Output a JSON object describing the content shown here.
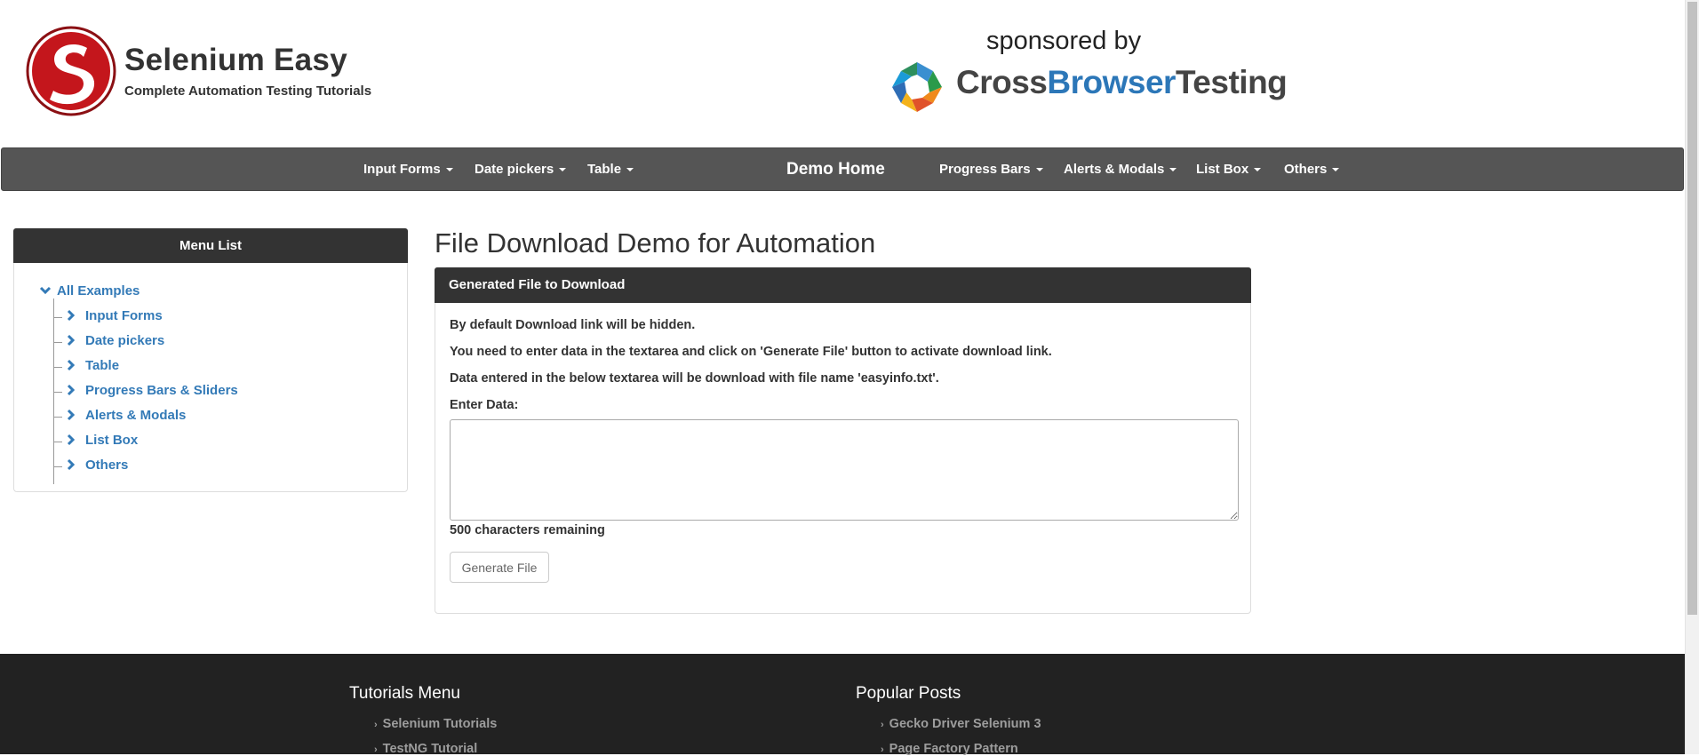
{
  "header": {
    "brand_title": "Selenium Easy",
    "brand_subtitle": "Complete Automation Testing Tutorials",
    "sponsor_by": "sponsored by",
    "sponsor_name_part1": "Cross",
    "sponsor_name_part2": "Browser",
    "sponsor_name_part3": "Testing"
  },
  "navbar": {
    "items": [
      {
        "label": "Input Forms"
      },
      {
        "label": "Date pickers"
      },
      {
        "label": "Table"
      },
      {
        "label": "Demo Home"
      },
      {
        "label": "Progress Bars"
      },
      {
        "label": "Alerts & Modals"
      },
      {
        "label": "List Box"
      },
      {
        "label": "Others"
      }
    ]
  },
  "sidebar": {
    "title": "Menu List",
    "root": "All Examples",
    "items": [
      {
        "label": "Input Forms"
      },
      {
        "label": "Date pickers"
      },
      {
        "label": "Table"
      },
      {
        "label": "Progress Bars & Sliders"
      },
      {
        "label": "Alerts & Modals"
      },
      {
        "label": "List Box"
      },
      {
        "label": "Others"
      }
    ]
  },
  "main": {
    "title": "File Download Demo for Automation",
    "panel_title": "Generated File to Download",
    "line1": "By default Download link will be hidden.",
    "line2": "You need to enter data in the textarea and click on 'Generate File' button to activate download link.",
    "line3": "Data entered in the below textarea will be download with file name 'easyinfo.txt'.",
    "enter_label": "Enter Data:",
    "textarea_value": "",
    "chars_remaining": "500 characters remaining",
    "generate_button": "Generate File"
  },
  "footer": {
    "tutorials_heading": "Tutorials Menu",
    "tutorials_links": [
      {
        "label": "Selenium Tutorials"
      },
      {
        "label": "TestNG Tutorial"
      }
    ],
    "popular_heading": "Popular Posts",
    "popular_links": [
      {
        "label": "Gecko Driver Selenium 3"
      },
      {
        "label": "Page Factory Pattern"
      }
    ]
  },
  "colors": {
    "navbar_bg": "#555555",
    "panel_header_bg": "#333333",
    "link_blue": "#337ab7",
    "footer_bg": "#222222",
    "brand_red": "#c4161c"
  }
}
